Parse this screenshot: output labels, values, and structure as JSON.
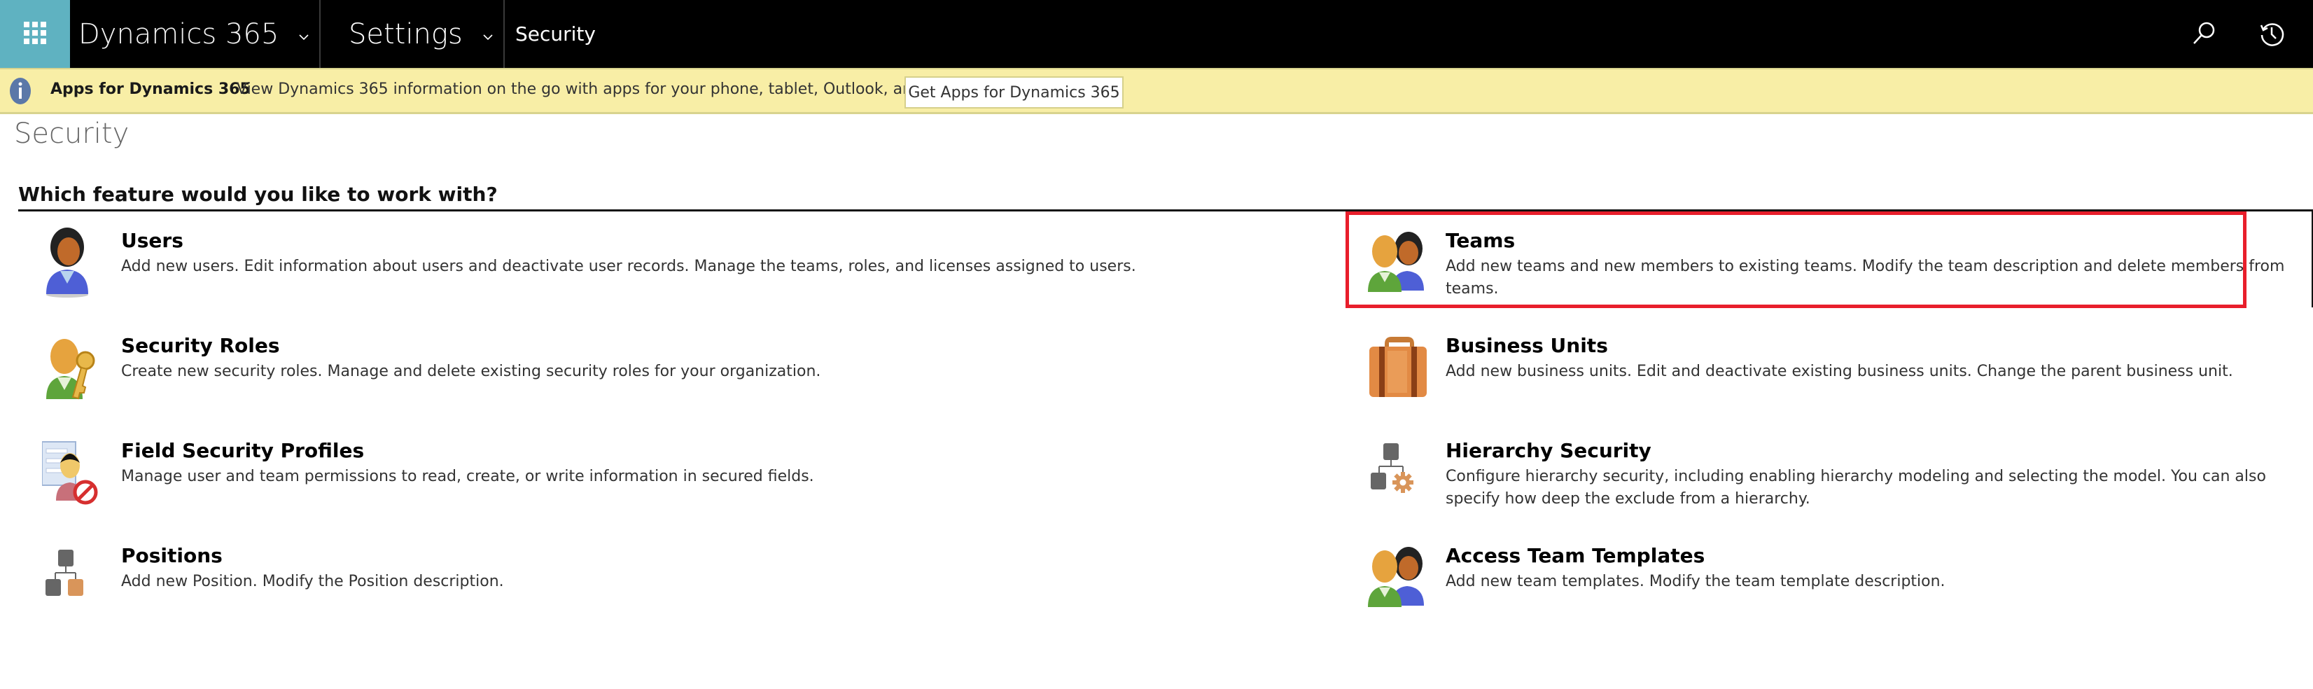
{
  "navbar": {
    "app_launcher_icon": "waffle-grid-icon",
    "app_name": "Dynamics 365",
    "area_name": "Settings",
    "breadcrumb_current": "Security",
    "search_icon": "search-icon",
    "recent_icon": "history-icon",
    "colors": {
      "launcher_bg": "#5fb2c1",
      "bar_bg": "#000000"
    }
  },
  "banner": {
    "icon": "info-icon",
    "title": "Apps for Dynamics 365",
    "message": "View Dynamics 365 information on the go with apps for your phone, tablet, Outlook, and more!",
    "button_label": "Get Apps for Dynamics 365",
    "colors": {
      "bg": "#f8eea6"
    }
  },
  "page": {
    "title": "Security",
    "section_heading": "Which feature would you like to work with?"
  },
  "features": {
    "left": [
      {
        "icon": "user-icon",
        "title": "Users",
        "description": "Add new users. Edit information about users and deactivate user records. Manage the teams, roles, and licenses assigned to users."
      },
      {
        "icon": "security-role-key-icon",
        "title": "Security Roles",
        "description": "Create new security roles. Manage and delete existing security roles for your organization."
      },
      {
        "icon": "field-security-profile-icon",
        "title": "Field Security Profiles",
        "description": "Manage user and team permissions to read, create, or write information in secured fields."
      },
      {
        "icon": "position-hierarchy-icon",
        "title": "Positions",
        "description": "Add new Position. Modify the Position description."
      }
    ],
    "right": [
      {
        "icon": "teams-icon",
        "title": "Teams",
        "description": "Add new teams and new members to existing teams. Modify the team description and delete members from teams.",
        "highlighted": true
      },
      {
        "icon": "briefcase-icon",
        "title": "Business Units",
        "description": "Add new business units. Edit and deactivate existing business units. Change the parent business unit."
      },
      {
        "icon": "hierarchy-settings-icon",
        "title": "Hierarchy Security",
        "description": "Configure hierarchy security, including enabling hierarchy modeling and selecting the model. You can also specify how deep the exclude from a hierarchy."
      },
      {
        "icon": "teams-icon",
        "title": "Access Team Templates",
        "description": "Add new team templates. Modify the team template description."
      }
    ],
    "highlight_color": "#e81e2b"
  }
}
